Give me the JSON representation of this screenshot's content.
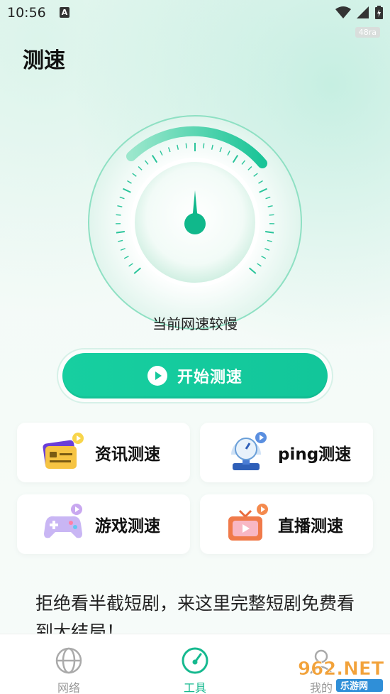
{
  "status_bar": {
    "time": "10:56",
    "badge": "48ra"
  },
  "page": {
    "title": "测速"
  },
  "gauge": {
    "status_text": "当前网速较慢"
  },
  "start_button": {
    "label": "开始测速"
  },
  "tools": [
    {
      "label": "资讯测速",
      "icon": "news-speed-icon"
    },
    {
      "label": "ping测速",
      "icon": "scale-ping-icon"
    },
    {
      "label": "游戏测速",
      "icon": "gamepad-icon"
    },
    {
      "label": "直播测速",
      "icon": "tv-live-icon"
    }
  ],
  "promo_text": "拒绝看半截短剧，来这里完整短剧免费看到大结局！",
  "tabbar": {
    "tabs": [
      {
        "label": "网络"
      },
      {
        "label": "工具"
      },
      {
        "label": "我的"
      }
    ]
  },
  "watermark": {
    "text": "962.NET",
    "sub": "乐游网"
  },
  "colors": {
    "accent": "#16c99c",
    "accent_dark": "#0fa882"
  }
}
